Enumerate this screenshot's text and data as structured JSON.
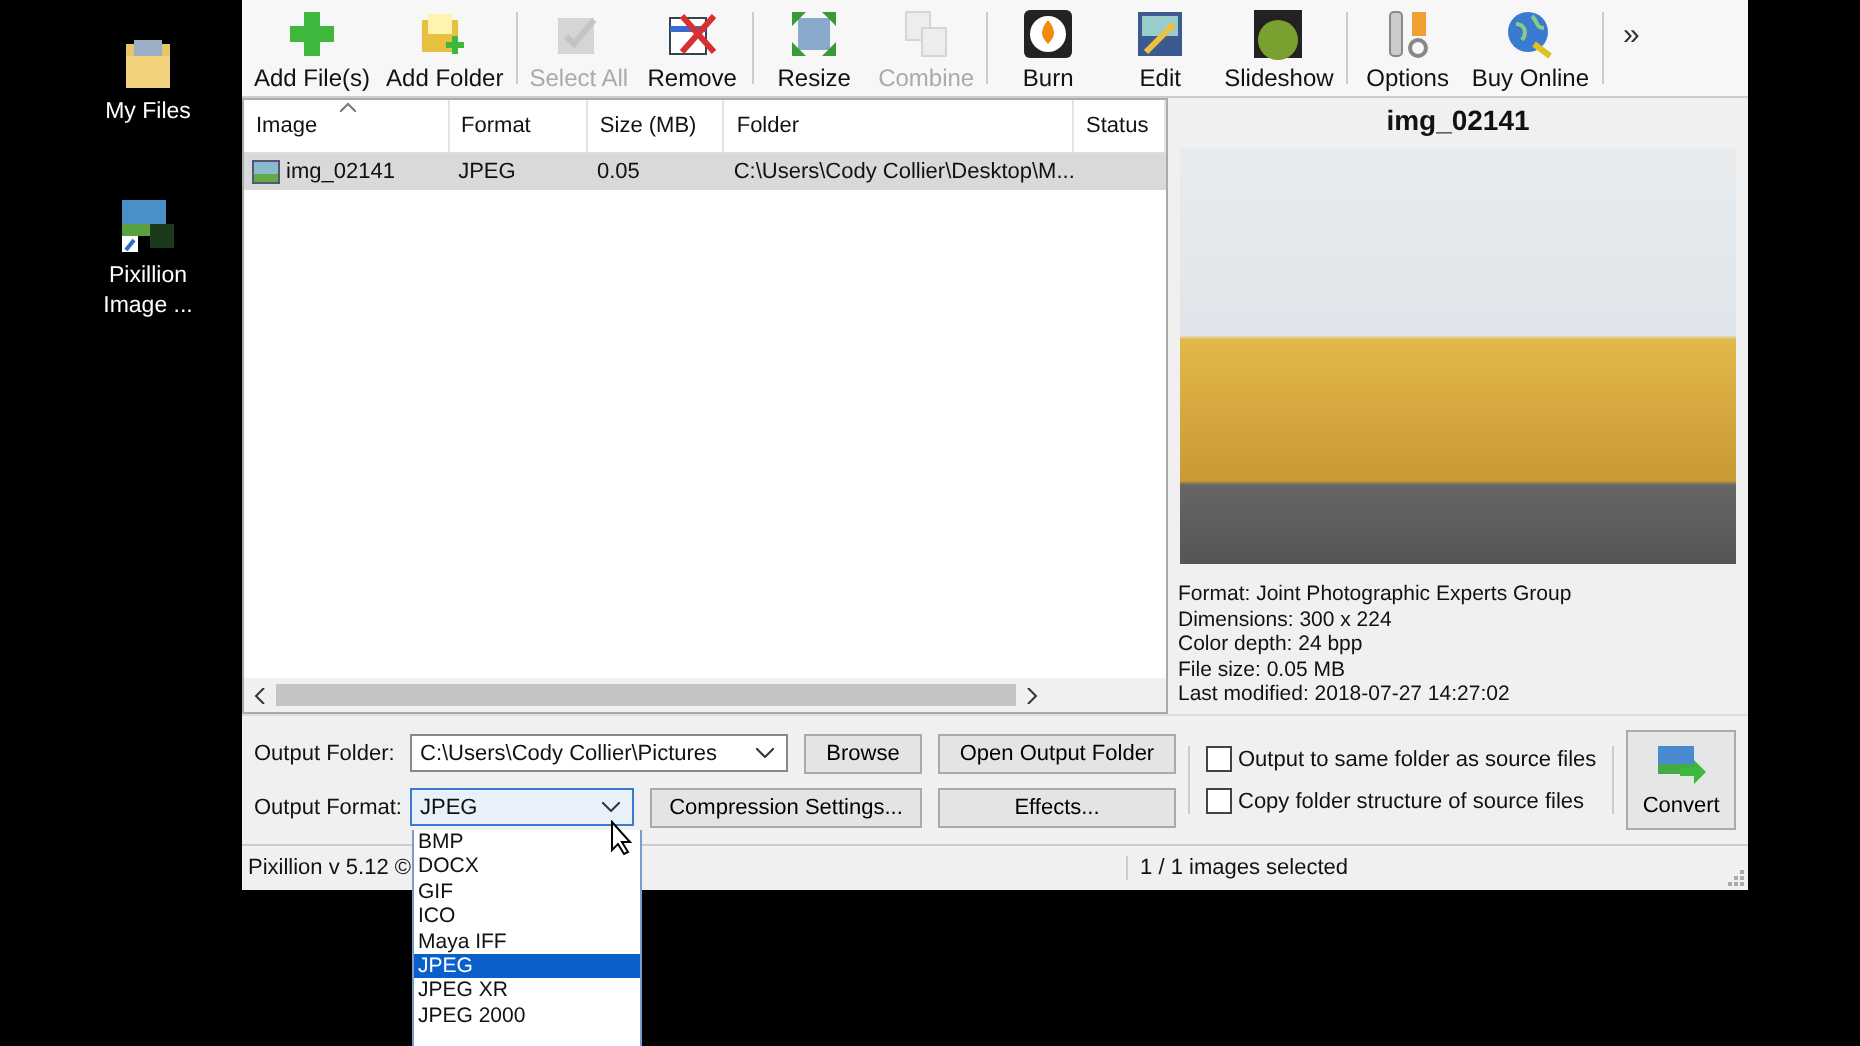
{
  "desktop": {
    "icons": [
      {
        "label": "My Files",
        "kind": "folder"
      },
      {
        "label": "Pixillion Image ...",
        "kind": "app"
      }
    ]
  },
  "toolbar": {
    "groups": [
      [
        {
          "label": "Add File(s)",
          "disabled": false
        },
        {
          "label": "Add Folder",
          "disabled": false
        }
      ],
      [
        {
          "label": "Select All",
          "disabled": true
        },
        {
          "label": "Remove",
          "disabled": false
        }
      ],
      [
        {
          "label": "Resize",
          "disabled": false
        },
        {
          "label": "Combine",
          "disabled": true
        }
      ],
      [
        {
          "label": "Burn",
          "disabled": false
        },
        {
          "label": "Edit",
          "disabled": false
        },
        {
          "label": "Slideshow",
          "disabled": false
        }
      ],
      [
        {
          "label": "Options",
          "disabled": false
        },
        {
          "label": "Buy Online",
          "disabled": false
        }
      ]
    ],
    "overflow": "»"
  },
  "table": {
    "columns": [
      "Image",
      "Format",
      "Size (MB)",
      "Folder",
      "Status"
    ],
    "rows": [
      {
        "cells": [
          "img_02141",
          "JPEG",
          "0.05",
          "C:\\Users\\Cody Collier\\Desktop\\M...",
          ""
        ],
        "selected": true
      }
    ]
  },
  "preview": {
    "title": "img_02141",
    "info": [
      "Format: Joint Photographic Experts Group",
      "Dimensions: 300 x 224",
      "Color depth: 24 bpp",
      "File size: 0.05 MB",
      "Last modified: 2018-07-27 14:27:02"
    ]
  },
  "output": {
    "folder_label": "Output Folder:",
    "folder_value": "C:\\Users\\Cody Collier\\Pictures",
    "browse": "Browse",
    "open_folder": "Open Output Folder",
    "format_label": "Output Format:",
    "format_value": "JPEG",
    "compression": "Compression Settings...",
    "effects": "Effects...",
    "checkboxes": [
      {
        "label": "Output to same folder as source files",
        "checked": false
      },
      {
        "label": "Copy folder structure of source files",
        "checked": false
      }
    ],
    "convert": "Convert"
  },
  "format_dropdown": {
    "options": [
      {
        "label": "BMP",
        "selected": false
      },
      {
        "label": "DOCX",
        "selected": false
      },
      {
        "label": "GIF",
        "selected": false
      },
      {
        "label": "ICO",
        "selected": false
      },
      {
        "label": "Maya IFF",
        "selected": false
      },
      {
        "label": "JPEG",
        "selected": true
      },
      {
        "label": "JPEG XR",
        "selected": false
      },
      {
        "label": "JPEG 2000",
        "selected": false
      }
    ]
  },
  "status_bar": {
    "version": "Pixillion v 5.12 ©",
    "selection": "1 / 1 images selected"
  }
}
